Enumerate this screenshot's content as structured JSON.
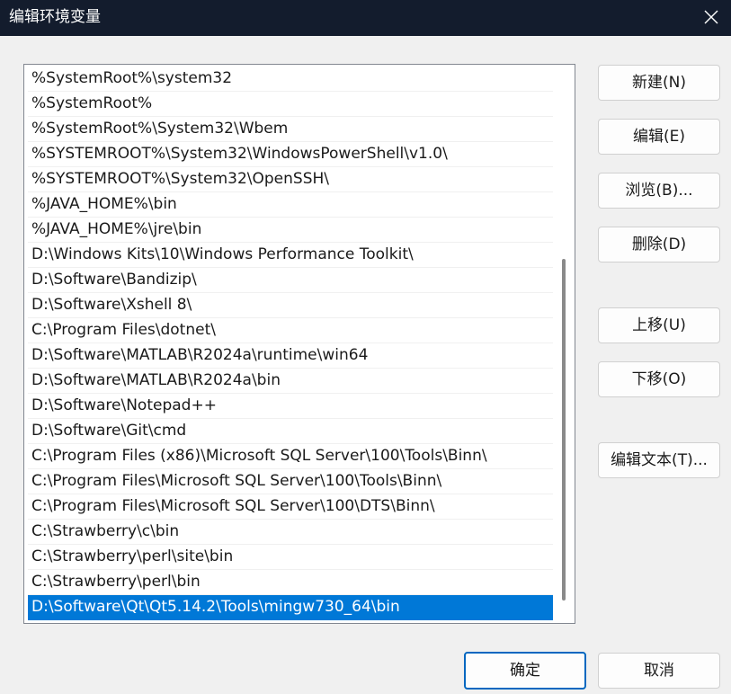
{
  "window": {
    "title": "编辑环境变量"
  },
  "path_list": {
    "items": [
      "%SystemRoot%\\system32",
      "%SystemRoot%",
      "%SystemRoot%\\System32\\Wbem",
      "%SYSTEMROOT%\\System32\\WindowsPowerShell\\v1.0\\",
      "%SYSTEMROOT%\\System32\\OpenSSH\\",
      "%JAVA_HOME%\\bin",
      "%JAVA_HOME%\\jre\\bin",
      "D:\\Windows Kits\\10\\Windows Performance Toolkit\\",
      "D:\\Software\\Bandizip\\",
      "D:\\Software\\Xshell 8\\",
      "C:\\Program Files\\dotnet\\",
      "D:\\Software\\MATLAB\\R2024a\\runtime\\win64",
      "D:\\Software\\MATLAB\\R2024a\\bin",
      "D:\\Software\\Notepad++",
      "D:\\Software\\Git\\cmd",
      "C:\\Program Files (x86)\\Microsoft SQL Server\\100\\Tools\\Binn\\",
      "C:\\Program Files\\Microsoft SQL Server\\100\\Tools\\Binn\\",
      "C:\\Program Files\\Microsoft SQL Server\\100\\DTS\\Binn\\",
      "C:\\Strawberry\\c\\bin",
      "C:\\Strawberry\\perl\\site\\bin",
      "C:\\Strawberry\\perl\\bin",
      "D:\\Software\\Qt\\Qt5.14.2\\Tools\\mingw730_64\\bin"
    ],
    "selected_index": 21
  },
  "buttons": {
    "new": "新建(N)",
    "edit": "编辑(E)",
    "browse": "浏览(B)...",
    "delete": "删除(D)",
    "move_up": "上移(U)",
    "move_down": "下移(O)",
    "edit_text": "编辑文本(T)...",
    "ok": "确定",
    "cancel": "取消"
  },
  "colors": {
    "titlebar": "#131c2d",
    "selection": "#0078d7",
    "default_button_border": "#0067c0"
  }
}
